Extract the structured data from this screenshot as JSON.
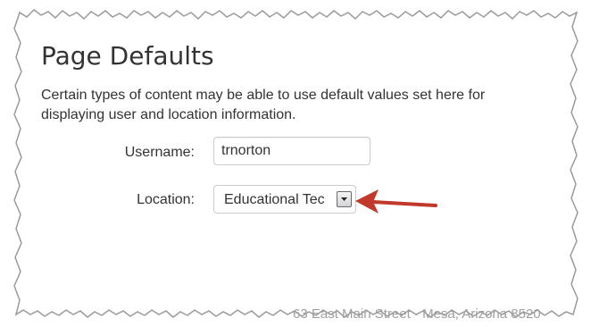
{
  "page": {
    "title": "Page Defaults",
    "intro": "Certain types of content may be able to use default values set here for displaying user and location information."
  },
  "form": {
    "username_label": "Username:",
    "username_value": "trnorton",
    "location_label": "Location:",
    "location_value": "Educational Tec"
  },
  "footer": {
    "address": "63 East Main Street · Mesa, Arizona 8520"
  },
  "colors": {
    "annotation_arrow": "#c0392b",
    "text": "#333333",
    "footer_text": "#a0a0a0"
  },
  "icons": {
    "select_toggle": "chevron-down-icon",
    "annotation": "arrow-left-icon"
  }
}
